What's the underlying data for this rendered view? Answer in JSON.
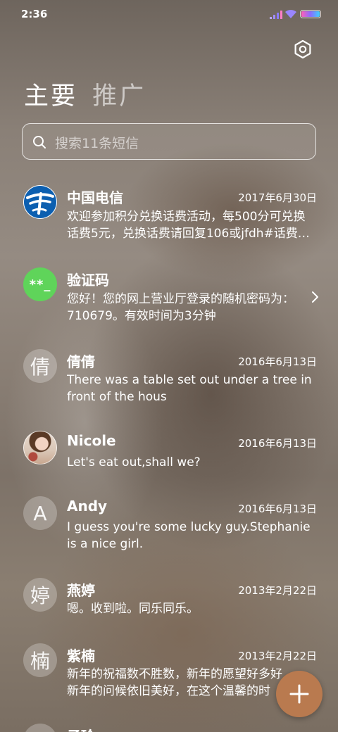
{
  "status_bar": {
    "time": "2:36"
  },
  "header": {
    "tabs": [
      {
        "label": "主要",
        "active": true
      },
      {
        "label": "推广",
        "active": false
      }
    ]
  },
  "search": {
    "placeholder": "搜索11条短信"
  },
  "conversations": [
    {
      "name": "中国电信",
      "date": "2017年6月30日",
      "preview_line1": "欢迎参加积分兑换话费活动，每500分可兑换",
      "preview_line2": "话费5元，兑换话费请回复106或jfdh#话费…",
      "avatar": "china-telecom-logo"
    },
    {
      "name": "验证码",
      "date": "",
      "preview_line1": "您好！您的网上营业厅登录的随机密码为：",
      "preview_line2": "710679。有效时间为3分钟",
      "avatar_text": "**_"
    },
    {
      "name": "倩倩",
      "date": "2016年6月13日",
      "preview_line1": "There was a table set out under a tree in",
      "preview_line2": "front of the hous",
      "avatar_text": "倩"
    },
    {
      "name": "Nicole",
      "date": "2016年6月13日",
      "preview_line1": "Let's eat out,shall we?",
      "preview_line2": "",
      "avatar": "photo"
    },
    {
      "name": "Andy",
      "date": "2016年6月13日",
      "preview_line1": "I guess you're some lucky guy.Stephanie",
      "preview_line2": "is a nice girl.",
      "avatar_text": "A"
    },
    {
      "name": "燕婷",
      "date": "2013年2月22日",
      "preview_line1": "嗯。收到啦。同乐同乐。",
      "preview_line2": "",
      "avatar_text": "婷"
    },
    {
      "name": "紫楠",
      "date": "2013年2月22日",
      "preview_line1": "新年的祝福数不胜数，新年的愿望好多好",
      "preview_line2": "新年的问候依旧美好，在这个温馨的时",
      "avatar_text": "楠"
    },
    {
      "name": "子玲",
      "date": "",
      "preview_line1": "",
      "preview_line2": "",
      "avatar_text": ""
    }
  ],
  "colors": {
    "verification_avatar": "#5fd45a",
    "fab": "#b97a4f",
    "telecom_blue": "#0c5fb0"
  }
}
